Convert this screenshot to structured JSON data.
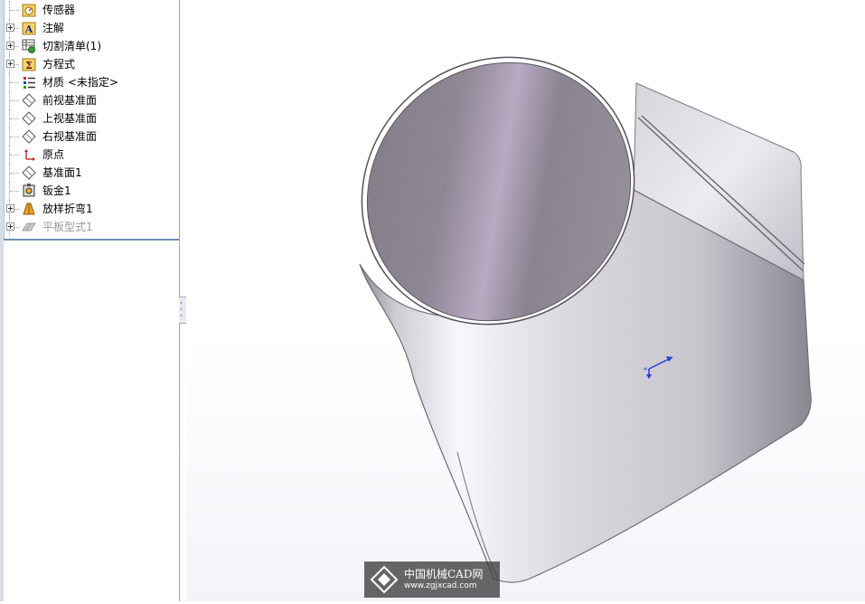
{
  "feature_tree": {
    "items": [
      {
        "label": "传感器",
        "icon": "sensor-icon",
        "expandable": false,
        "disabled": false
      },
      {
        "label": "注解",
        "icon": "annotation-folder-icon",
        "expandable": true,
        "disabled": false
      },
      {
        "label": "切割清单(1)",
        "icon": "cut-list-icon",
        "expandable": true,
        "disabled": false
      },
      {
        "label": "方程式",
        "icon": "equation-folder-icon",
        "expandable": true,
        "disabled": false
      },
      {
        "label": "材质 <未指定>",
        "icon": "material-icon",
        "expandable": false,
        "disabled": false
      },
      {
        "label": "前视基准面",
        "icon": "plane-icon",
        "expandable": false,
        "disabled": false
      },
      {
        "label": "上视基准面",
        "icon": "plane-icon",
        "expandable": false,
        "disabled": false
      },
      {
        "label": "右视基准面",
        "icon": "plane-icon",
        "expandable": false,
        "disabled": false
      },
      {
        "label": "原点",
        "icon": "origin-icon",
        "expandable": false,
        "disabled": false
      },
      {
        "label": "基准面1",
        "icon": "plane-icon",
        "expandable": false,
        "disabled": false
      },
      {
        "label": "钣金1",
        "icon": "sheet-metal-icon",
        "expandable": false,
        "disabled": false
      },
      {
        "label": "放样折弯1",
        "icon": "lofted-bend-icon",
        "expandable": true,
        "disabled": false
      },
      {
        "label": "平板型式1",
        "icon": "flat-pattern-icon",
        "expandable": true,
        "disabled": true
      }
    ]
  },
  "watermark": {
    "title": "中国机械CAD网",
    "url": "www.zgjxcad.com"
  },
  "colors": {
    "model_light": "#f3f2f6",
    "model_mid": "#c9c6cf",
    "model_dark": "#7a777f",
    "interior_dark": "#8b858e",
    "interior_accent": "#b7a3c0",
    "triad_blue": "#1d3fd6"
  }
}
